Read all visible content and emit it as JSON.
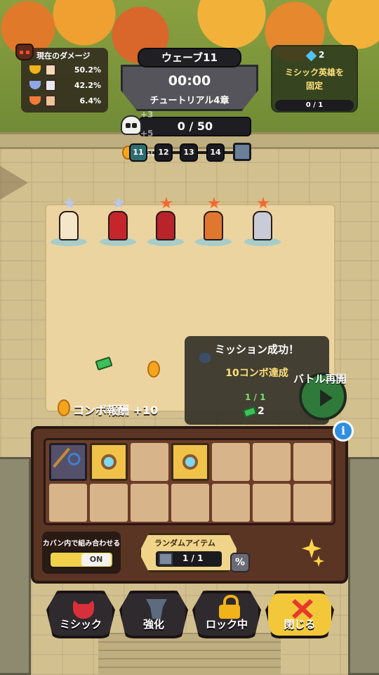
{
  "damage_panel": {
    "title": "現在のダメージ",
    "rows": [
      {
        "rank": "gold",
        "value": "50.2%"
      },
      {
        "rank": "silver",
        "value": "42.2%"
      },
      {
        "rank": "bronze",
        "value": "6.4%"
      }
    ]
  },
  "wave": {
    "title": "ウェーブ11",
    "timer": "00:00",
    "chapter": "チュートリアル4章"
  },
  "mythic_lock": {
    "gem_count": "2",
    "title_line1": "ミシック英雄を",
    "title_line2": "固定",
    "progress": "0 / 1"
  },
  "enemy_counter": {
    "value": "0 / 50",
    "float_exp": "+3",
    "float_bonus": "+5",
    "float_coin": "+50"
  },
  "upcoming_waves": [
    "11",
    "12",
    "13",
    "14"
  ],
  "combo_reward": {
    "label": "コンボ報酬 +10"
  },
  "mission": {
    "title": "ミッション成功！",
    "description": "10コンボ達成",
    "progress": "1 / 1",
    "reward": "2"
  },
  "battle_button": {
    "label": "バトル再開"
  },
  "info_button": {
    "label": "i"
  },
  "inventory": {
    "rows": 2,
    "cols": 7,
    "items": [
      {
        "slot": 0,
        "icon": "wand-icon"
      },
      {
        "slot": 1,
        "icon": "ring-icon"
      },
      {
        "slot": 3,
        "icon": "ring-icon"
      }
    ]
  },
  "combine_toggle": {
    "label": "カバン内で組み合わせる",
    "state": "ON"
  },
  "random_item": {
    "label": "ランダムアイテム",
    "count": "1 / 1",
    "percent_label": "%"
  },
  "bottom_buttons": [
    {
      "label": "ミシック",
      "icon": "demon-icon"
    },
    {
      "label": "強化",
      "icon": "anvil-icon"
    },
    {
      "label": "ロック中",
      "icon": "lock-icon"
    },
    {
      "label": "閉じる",
      "icon": "close-icon"
    }
  ],
  "colors": {
    "accent_gold": "#f2c83a",
    "mission_text": "#ffe27a",
    "mission_progress": "#7fe07a",
    "info_blue": "#2f8fe0",
    "battle_green": "#2f7a3a"
  }
}
